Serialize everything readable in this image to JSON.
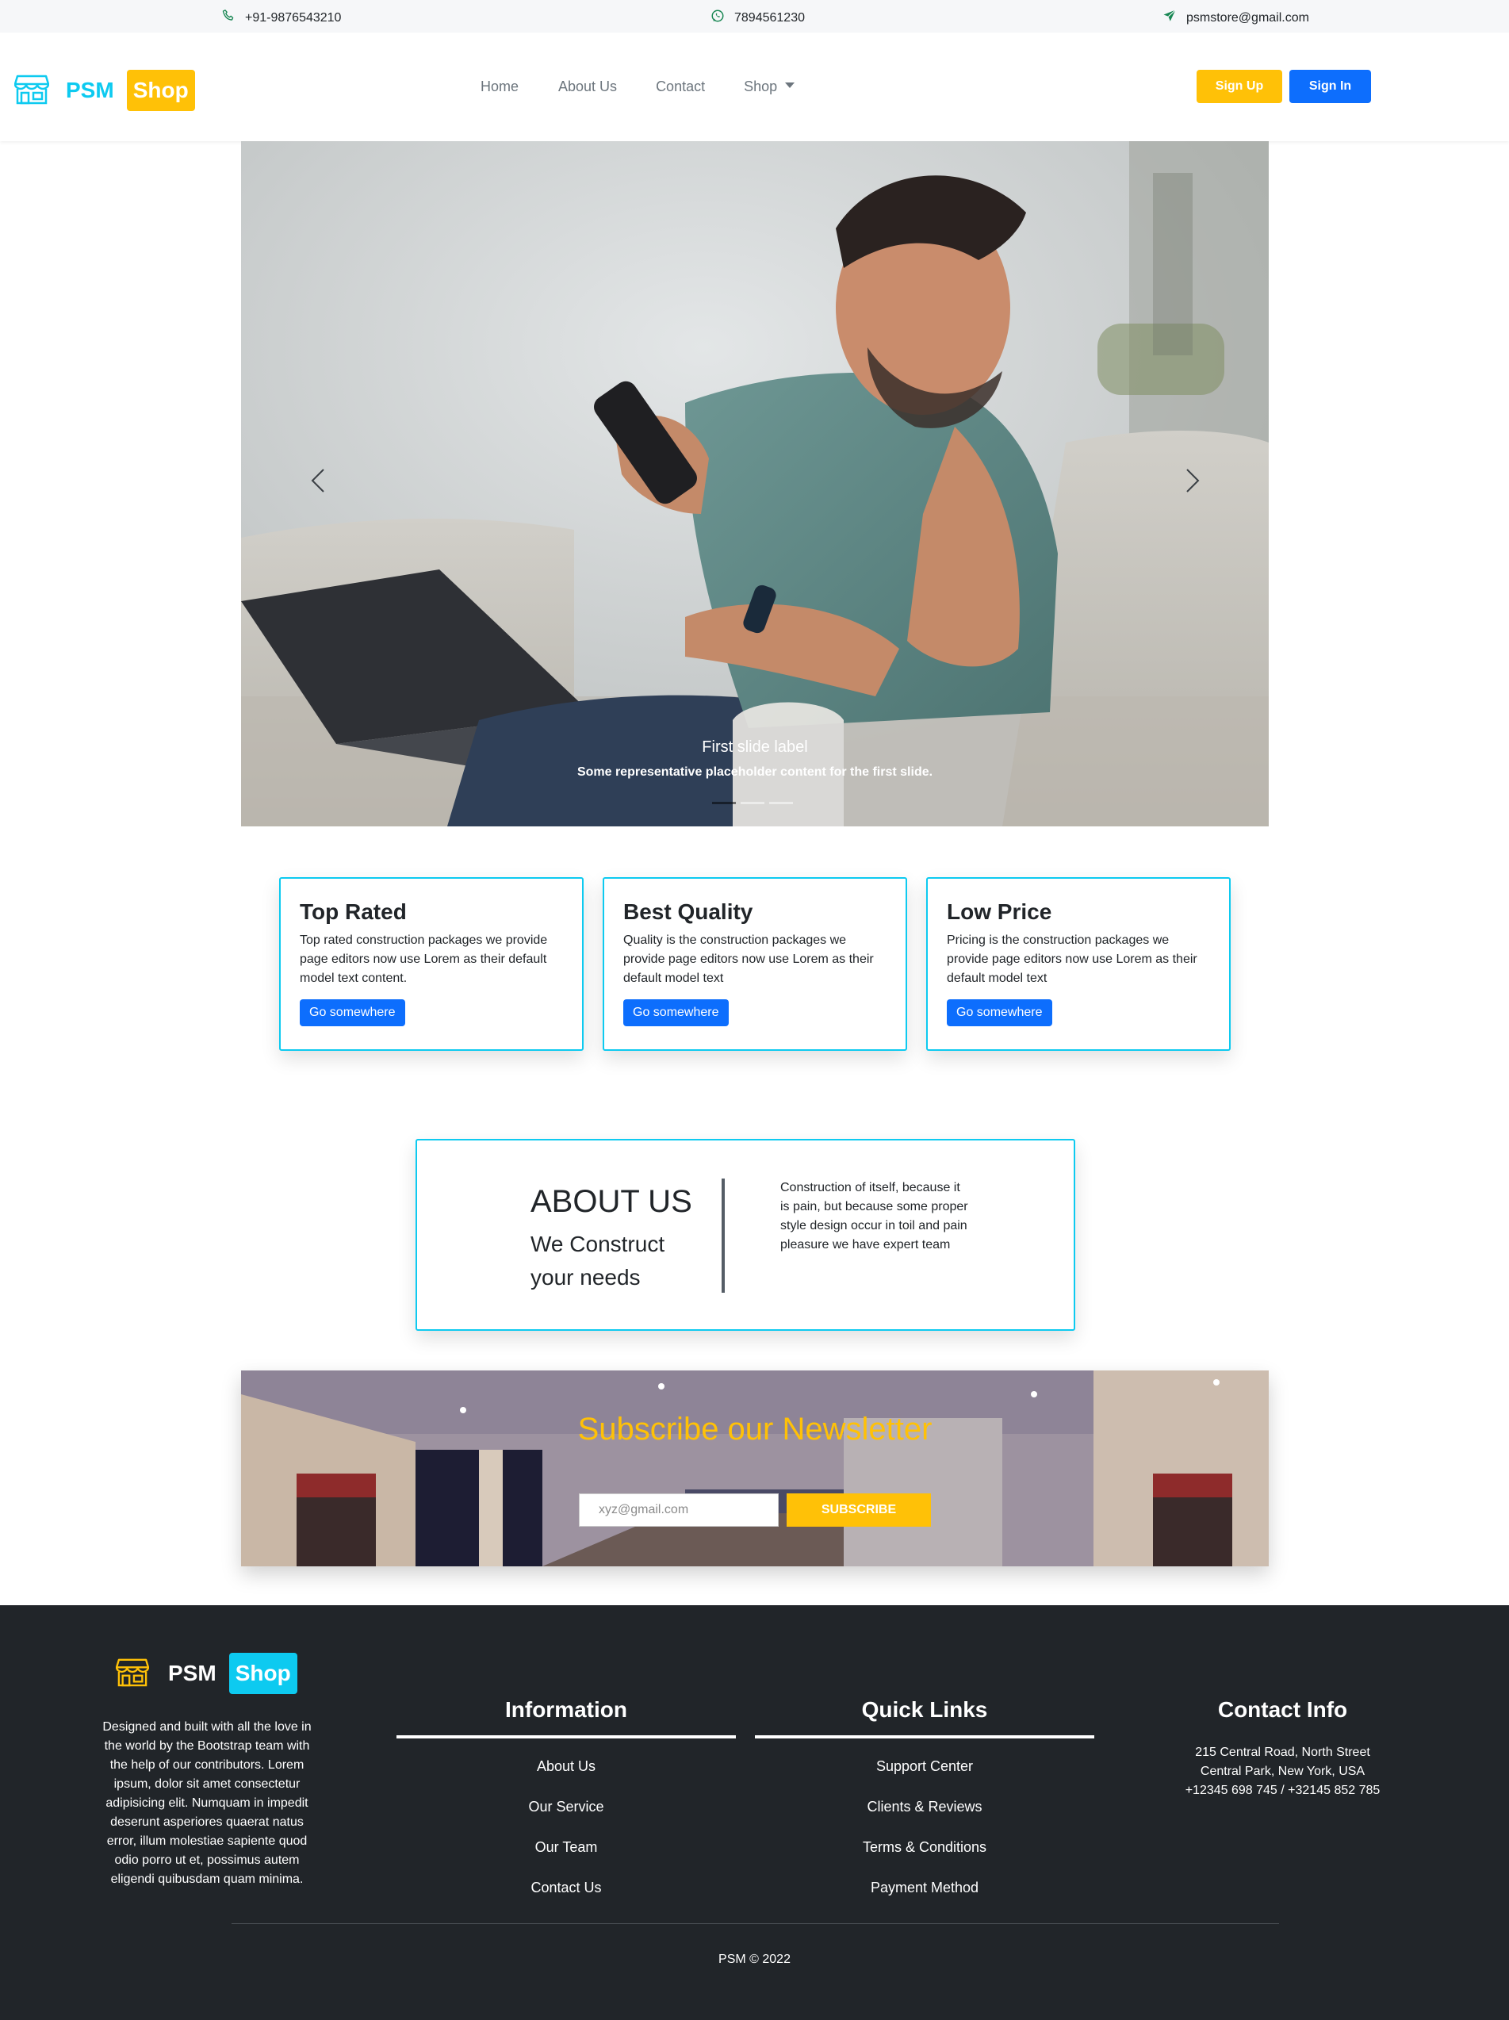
{
  "topbar": {
    "phone": "+91-9876543210",
    "whatsapp": "7894561230",
    "email": "psmstore@gmail.com"
  },
  "navbar": {
    "brand_psm": "PSM",
    "brand_shop": "Shop",
    "links": [
      "Home",
      "About Us",
      "Contact",
      "Shop"
    ],
    "signup": "Sign Up",
    "signin": "Sign In"
  },
  "hero": {
    "caption_title": "First slide label",
    "caption_text": "Some representative placeholder content for the first slide."
  },
  "cards": [
    {
      "title": "Top Rated",
      "text": "Top rated construction packages we provide page editors now use Lorem as their default model text content.",
      "button": "Go somewhere"
    },
    {
      "title": "Best Quality",
      "text": "Quality is the construction packages we provide page editors now use Lorem as their default model text",
      "button": "Go somewhere"
    },
    {
      "title": "Low Price",
      "text": "Pricing is the construction packages we provide page editors now use Lorem as their default model text",
      "button": "Go somewhere"
    }
  ],
  "about": {
    "title": "ABOUT US",
    "subtitle": "We Construct your needs",
    "text": "Construction of itself, because it is pain, but because some proper style design occur in toil and pain pleasure we have expert team"
  },
  "newsletter": {
    "title": "Subscribe our Newsletter",
    "placeholder": "xyz@gmail.com",
    "button": "SUBSCRIBE"
  },
  "footer": {
    "brand_psm": "PSM",
    "brand_shop": "Shop",
    "description": "Designed and built with all the love in the world by the Bootstrap team with the help of our contributors. Lorem ipsum, dolor sit amet consectetur adipisicing elit. Numquam in impedit deserunt asperiores quaerat natus error, illum molestiae sapiente quod odio porro ut et, possimus autem eligendi quibusdam quam minima.",
    "information": {
      "title": "Information",
      "links": [
        "About Us",
        "Our Service",
        "Our Team",
        "Contact Us"
      ]
    },
    "quick_links": {
      "title": "Quick Links",
      "links": [
        "Support Center",
        "Clients & Reviews",
        "Terms & Conditions",
        "Payment Method"
      ]
    },
    "contact": {
      "title": "Contact Info",
      "address1": "215 Central Road, North Street",
      "address2": "Central Park, New York, USA",
      "phones": "+12345 698 745 / +32145 852 785"
    },
    "copyright": "PSM © 2022"
  },
  "colors": {
    "accent_cyan": "#0dcaf0",
    "accent_yellow": "#ffc107",
    "primary_blue": "#0d6efd",
    "footer_bg": "#212529"
  },
  "icons": [
    "phone-icon",
    "whatsapp-icon",
    "send-icon",
    "store-icon",
    "chevron-left-icon",
    "chevron-right-icon",
    "caret-down-icon"
  ]
}
